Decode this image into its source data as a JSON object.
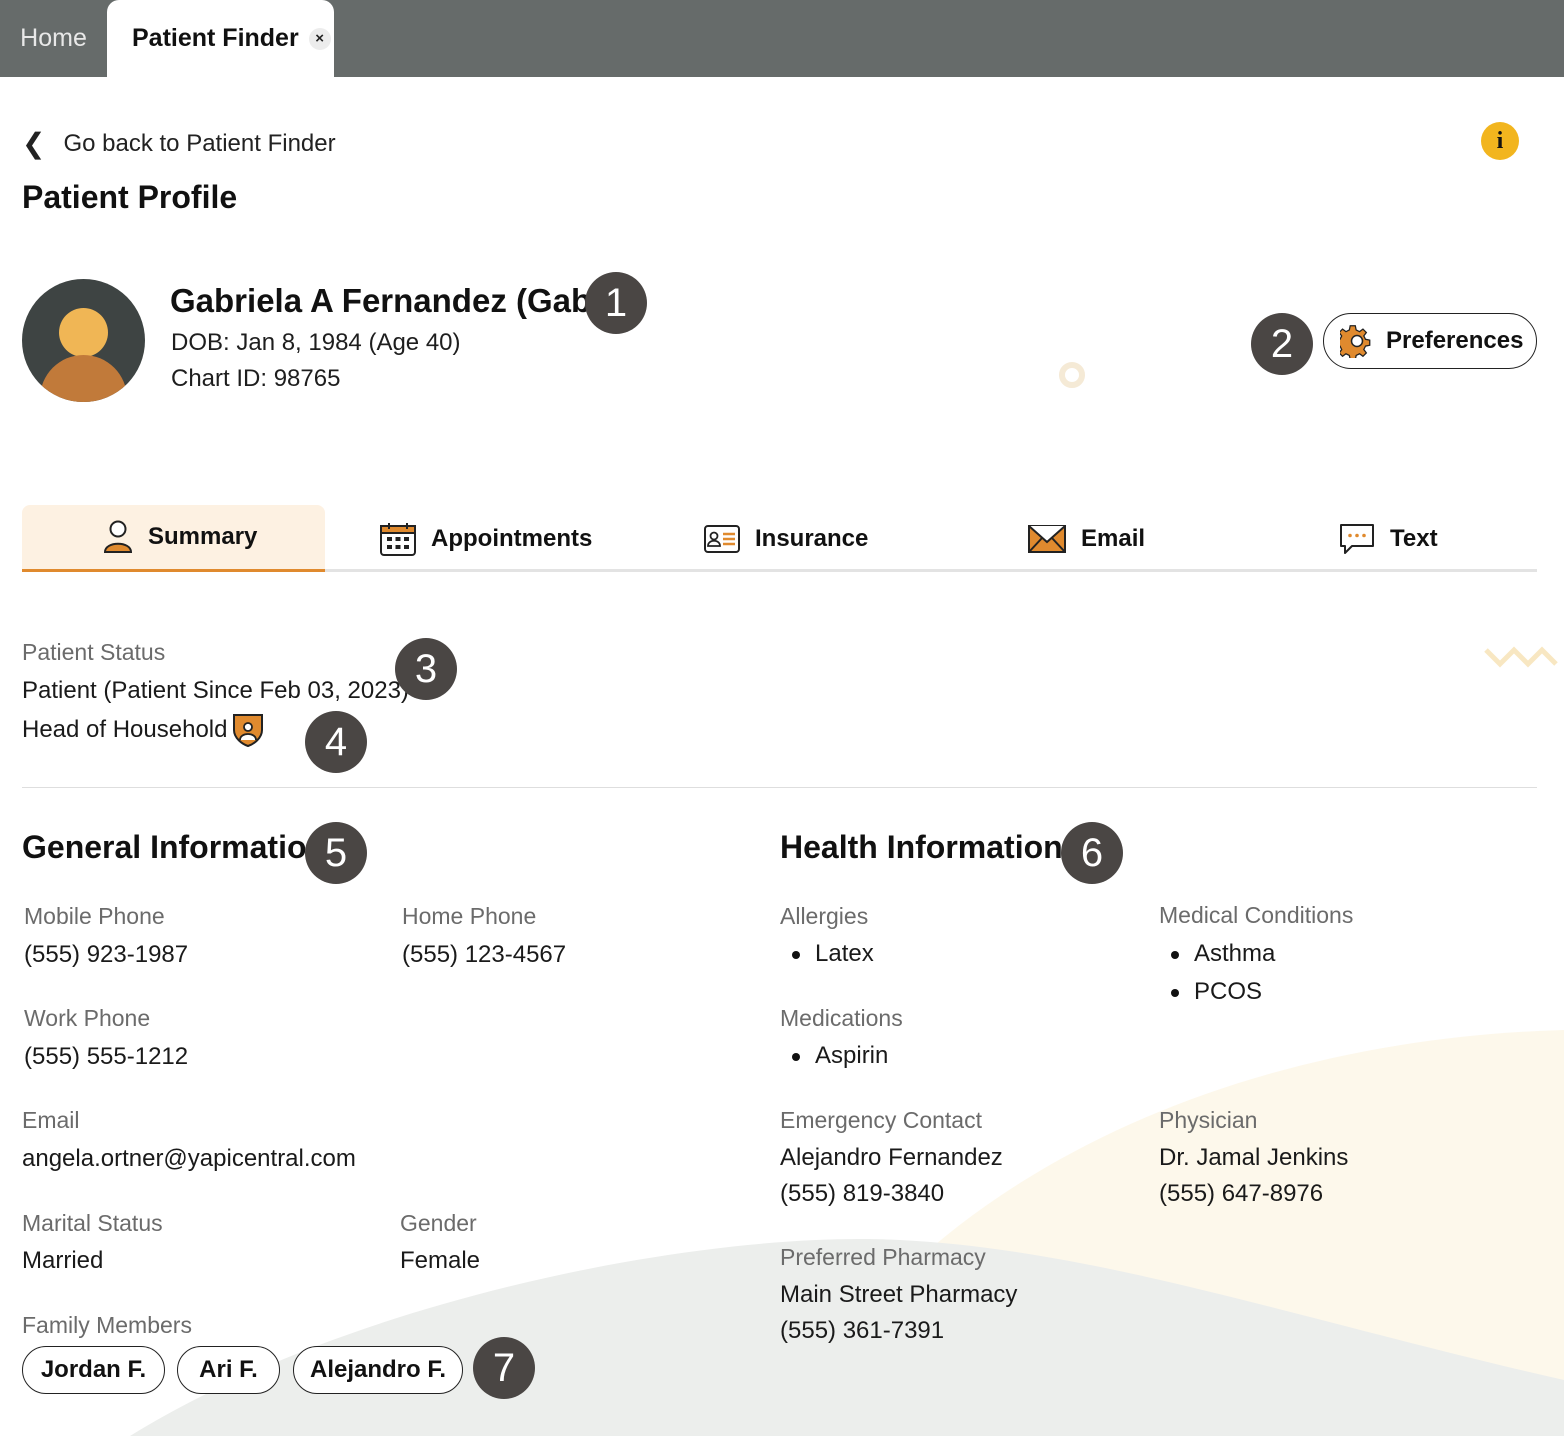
{
  "app_tabs": [
    {
      "label": "Home"
    },
    {
      "label": "Patient Finder",
      "close_icon": "×"
    }
  ],
  "back_link": {
    "label": "Go back to Patient Finder",
    "icon": "chevron-left-icon"
  },
  "info_icon": {
    "glyph": "i",
    "color": "#f2b51e"
  },
  "page_title": "Patient Profile",
  "patient": {
    "name": "Gabriela A Fernandez (Gabby)",
    "dob": "DOB: Jan 8, 1984 (Age 40)",
    "chart_id": "Chart ID: 98765"
  },
  "preferences_button": {
    "label": "Preferences",
    "icon": "gear-icon"
  },
  "callouts": [
    "1",
    "2",
    "3",
    "4",
    "5",
    "6",
    "7"
  ],
  "section_tabs": [
    {
      "label": "Summary",
      "icon": "user-icon",
      "active": true
    },
    {
      "label": "Appointments",
      "icon": "calendar-icon"
    },
    {
      "label": "Insurance",
      "icon": "id-card-icon"
    },
    {
      "label": "Email",
      "icon": "envelope-icon"
    },
    {
      "label": "Text",
      "icon": "chat-bubble-icon"
    }
  ],
  "status": {
    "label": "Patient Status",
    "value": "Patient (Patient Since Feb 03, 2023)",
    "household": "Head of Household",
    "household_icon": "household-shield-icon"
  },
  "general": {
    "heading": "General Information",
    "mobile_label": "Mobile Phone",
    "mobile_value": "(555) 923-1987",
    "home_label": "Home Phone",
    "home_value": "(555) 123-4567",
    "work_label": "Work Phone",
    "work_value": "(555) 555-1212",
    "email_label": "Email",
    "email_value": "angela.ortner@yapicentral.com",
    "marital_label": "Marital Status",
    "marital_value": "Married",
    "gender_label": "Gender",
    "gender_value": "Female",
    "family_label": "Family Members",
    "family": [
      "Jordan F.",
      "Ari F.",
      "Alejandro F."
    ]
  },
  "health": {
    "heading": "Health Information",
    "allergies_label": "Allergies",
    "allergies": [
      "Latex"
    ],
    "conditions_label": "Medical Conditions",
    "conditions": [
      "Asthma",
      "PCOS"
    ],
    "medications_label": "Medications",
    "medications": [
      "Aspirin"
    ],
    "emergency_label": "Emergency Contact",
    "emergency_name": "Alejandro Fernandez",
    "emergency_phone": "(555) 819-3840",
    "physician_label": "Physician",
    "physician_name": "Dr. Jamal Jenkins",
    "physician_phone": "(555) 647-8976",
    "pharmacy_label": "Preferred Pharmacy",
    "pharmacy_name": "Main Street Pharmacy",
    "pharmacy_phone": "(555) 361-7391"
  },
  "colors": {
    "accent": "#e08a2e",
    "tabbar": "#666b6a",
    "badge": "#4a4644",
    "active_tab_bg": "#fdf1e2"
  }
}
